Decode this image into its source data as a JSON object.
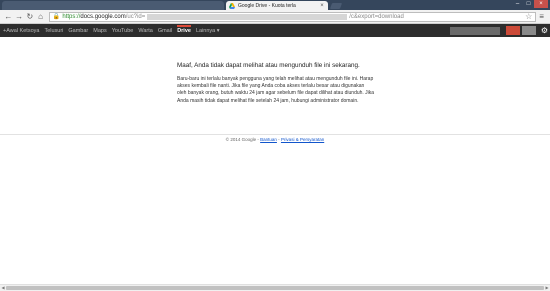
{
  "browser": {
    "active_tab_title": "Google Drive - Kuota terla",
    "url_scheme": "https://",
    "url_host": "docs.google.com",
    "url_path_start": "/uc?id=",
    "url_path_end": "/c&export=download"
  },
  "gbar": {
    "items": [
      {
        "label": "+Awal Ketsoya"
      },
      {
        "label": "Telusuri"
      },
      {
        "label": "Gambar"
      },
      {
        "label": "Maps"
      },
      {
        "label": "YouTube"
      },
      {
        "label": "Warta"
      },
      {
        "label": "Gmail"
      },
      {
        "label": "Drive",
        "active": true
      },
      {
        "label": "Lainnya ▾"
      }
    ]
  },
  "page": {
    "heading": "Maaf, Anda tidak dapat melihat atau mengunduh file ini sekarang.",
    "message": "Baru-baru ini terlalu banyak pengguna yang telah melihat atau mengunduh file ini. Harap akses kembali file nanti. Jika file yang Anda coba akses terlalu besar atau digunakan oleh banyak orang, butuh waktu 24 jam agar sebelum file dapat dilihat atau diunduh. Jika Anda masih tidak dapat melihat file setelah 24 jam, hubungi administrator domain."
  },
  "footer": {
    "copyright": "© 2014 Google -",
    "help_link": "Bantuan",
    "separator": "-",
    "privacy_link": "Privasi & Persyaratan"
  },
  "colors": {
    "tabstrip": "#35465c",
    "gbar": "#2d2d2d",
    "gbar_active_accent": "#dd4b39",
    "link": "#1155cc",
    "https_green": "#2e8b2e"
  },
  "icons": {
    "back": "arrow-left",
    "forward": "arrow-right",
    "reload": "reload",
    "home": "home",
    "lock": "lock",
    "star": "star",
    "menu": "hamburger",
    "settings": "gear"
  }
}
